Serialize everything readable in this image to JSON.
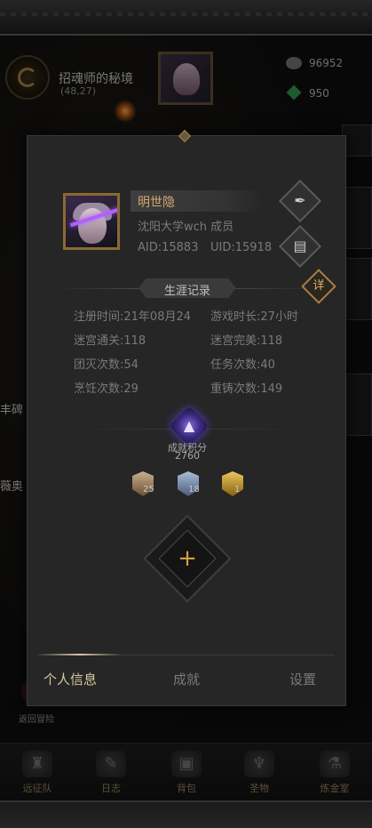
{
  "hud": {
    "map_name": "招魂师的秘境",
    "map_coords": "(48,27)",
    "resource_1": "96952",
    "resource_2": "950",
    "side_left_1": "丰碑",
    "side_left_2": "薇奥",
    "back_label": "返回冒险"
  },
  "profile": {
    "name": "明世隐",
    "guild": "沈阳大学wch 成员",
    "aid": "AID:15883",
    "uid": "UID:15918"
  },
  "career": {
    "title": "生涯记录",
    "detail_btn": "详",
    "stats": [
      {
        "label": "注册时间:",
        "value": "21年08月24"
      },
      {
        "label": "游戏时长:",
        "value": "27小时"
      },
      {
        "label": "迷宫通关:",
        "value": "118"
      },
      {
        "label": "迷宫完美:",
        "value": "118"
      },
      {
        "label": "团灭次数:",
        "value": "54"
      },
      {
        "label": "任务次数:",
        "value": "40"
      },
      {
        "label": "烹饪次数:",
        "value": "29"
      },
      {
        "label": "重铸次数:",
        "value": "149"
      }
    ]
  },
  "achievement": {
    "label": "成就积分",
    "value": "2760",
    "badges": [
      "25",
      "18",
      "1"
    ],
    "add_symbol": "+"
  },
  "tabs": {
    "personal": "个人信息",
    "achievements": "成就",
    "settings": "设置"
  },
  "nav": [
    {
      "label": "远征队",
      "icon": "helmet-icon"
    },
    {
      "label": "日志",
      "icon": "journal-icon"
    },
    {
      "label": "背包",
      "icon": "backpack-icon"
    },
    {
      "label": "圣物",
      "icon": "relic-icon"
    },
    {
      "label": "炼金室",
      "icon": "alchemy-icon"
    }
  ]
}
